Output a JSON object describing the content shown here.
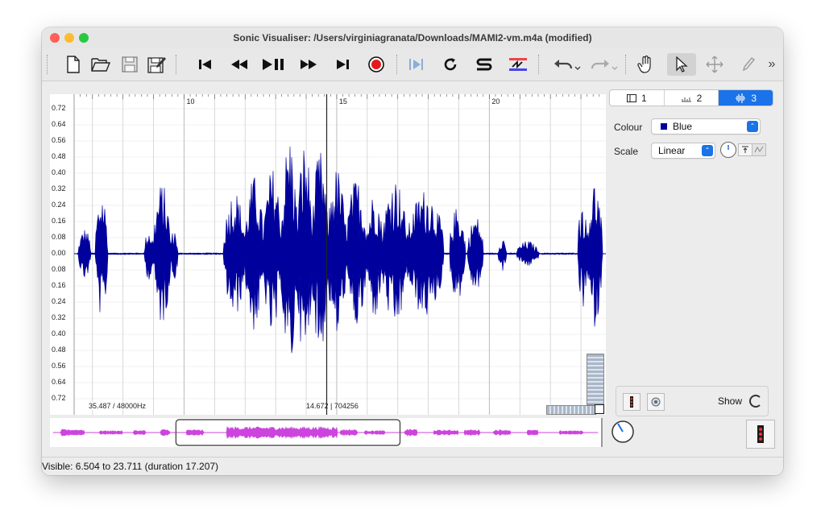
{
  "window": {
    "title": "Sonic Visualiser: /Users/virginiagranata/Downloads/MAMI2-vm.m4a (modified)"
  },
  "toolbar": {
    "items": [
      "new-file",
      "open-file",
      "save",
      "save-as",
      "rewind-to-start",
      "rewind",
      "play-pause",
      "fast-forward",
      "ffwd-to-end",
      "record",
      "play-selection",
      "loop",
      "solo",
      "align",
      "undo",
      "redo",
      "navigate",
      "select",
      "move",
      "draw",
      "more"
    ],
    "more_label": "»"
  },
  "pane": {
    "y_labels": [
      "0.72",
      "0.64",
      "0.56",
      "0.48",
      "0.40",
      "0.32",
      "0.24",
      "0.16",
      "0.08",
      "0.00",
      "0.08",
      "0.16",
      "0.24",
      "0.32",
      "0.40",
      "0.48",
      "0.56",
      "0.64",
      "0.72"
    ],
    "time_ticks": [
      {
        "label": "10",
        "value": 10
      },
      {
        "label": "15",
        "value": 15
      },
      {
        "label": "20",
        "value": 20
      }
    ],
    "visible_start": 6.504,
    "visible_end": 23.711,
    "playhead": 14.672,
    "info_left": "35.487 / 48000Hz",
    "info_mid": "14.672 | 704256",
    "wave_color": "#00009c"
  },
  "layer_tabs": [
    {
      "label": "1",
      "icon": "pane-icon"
    },
    {
      "label": "2",
      "icon": "ruler-icon"
    },
    {
      "label": "3",
      "icon": "waveform-icon",
      "selected": true
    }
  ],
  "properties": {
    "colour_label": "Colour",
    "colour_value": "Blue",
    "colour_swatch": "#00009c",
    "scale_label": "Scale",
    "scale_value": "Linear",
    "show_label": "Show"
  },
  "overview": {
    "wave_color": "#cc44dd",
    "selection": [
      8.0,
      22.6
    ]
  },
  "status": {
    "text": "Visible: 6.504 to 23.711 (duration 17.207)"
  },
  "colors": {
    "accent": "#1a73e8",
    "record": "#e41b1b"
  }
}
